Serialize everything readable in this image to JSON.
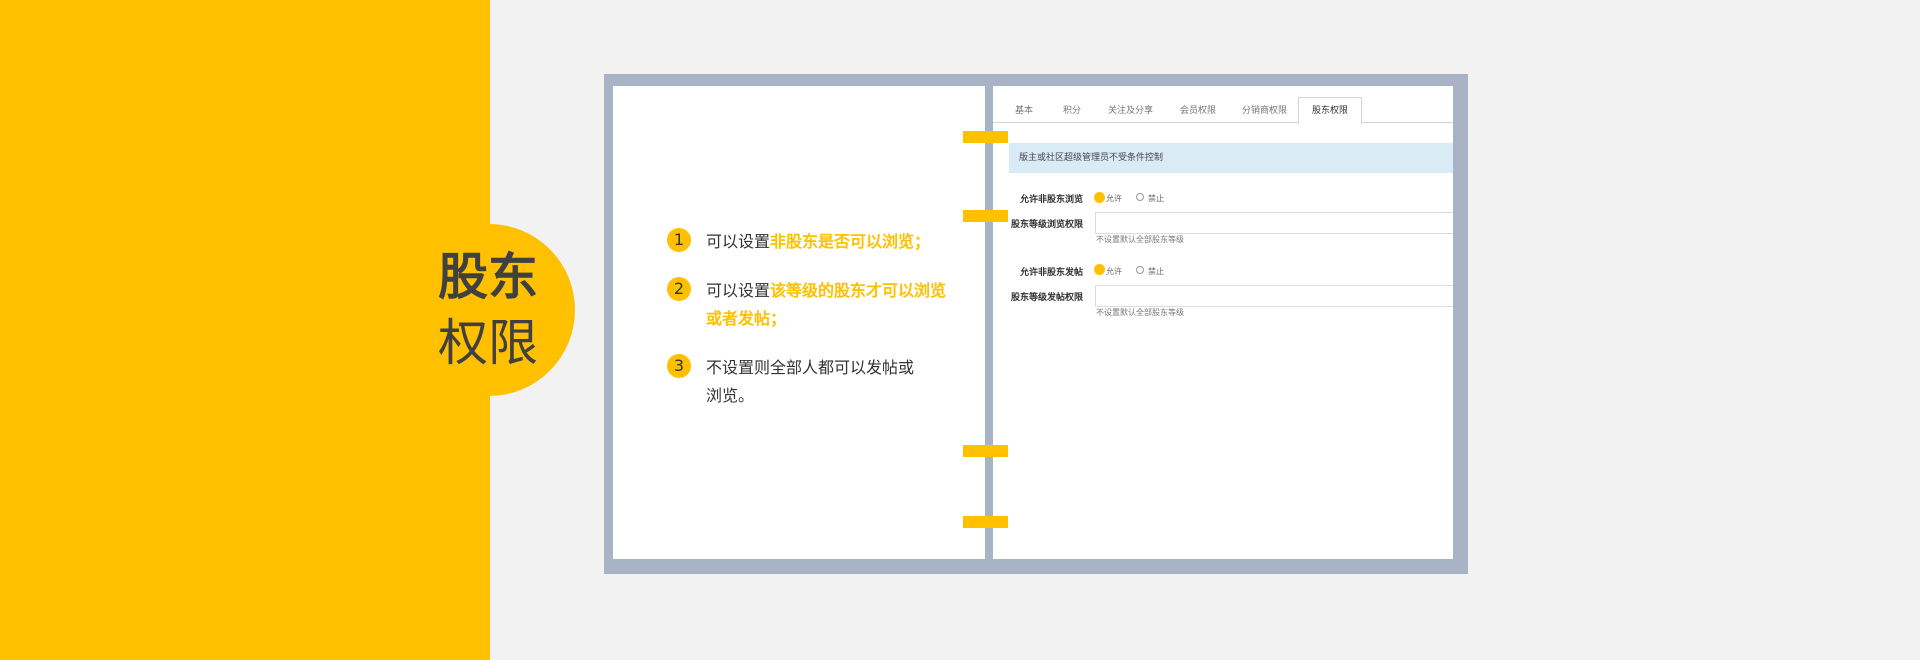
{
  "title": {
    "line1": "股东",
    "line2": "权限"
  },
  "points": [
    {
      "num": "1",
      "prefix": "可以设置",
      "highlight_line1": "非股东是否可以浏览；",
      "highlight_line2": "",
      "plain_line1": "",
      "plain_line2": ""
    },
    {
      "num": "2",
      "prefix": "可以设置",
      "highlight_line1": "该等级的股东才可以浏览",
      "highlight_line2": "或者发帖；",
      "plain_line1": "",
      "plain_line2": ""
    },
    {
      "num": "3",
      "prefix": "",
      "highlight_line1": "",
      "highlight_line2": "",
      "plain_line1": "不设置则全部人都可以发帖或",
      "plain_line2": "浏览。"
    }
  ],
  "tabs": [
    "基本",
    "积分",
    "关注及分享",
    "会员权限",
    "分销商权限",
    "股东权限"
  ],
  "active_tab": "股东权限",
  "notice": "版主或社区超级管理员不受条件控制",
  "form": {
    "browse": {
      "label": "允许非股东浏览",
      "allow": "允许",
      "deny": "禁止"
    },
    "browse_level": {
      "label": "股东等级浏览权限",
      "hint": "不设置默认全部股东等级"
    },
    "post": {
      "label": "允许非股东发帖",
      "allow": "允许",
      "deny": "禁止"
    },
    "post_level": {
      "label": "股东等级发帖权限",
      "hint": "不设置默认全部股东等级"
    }
  },
  "colors": {
    "accent": "#ffc000",
    "frame": "#a8b4c6",
    "background": "#f2f2f2",
    "notice": "#d9ebf5"
  }
}
